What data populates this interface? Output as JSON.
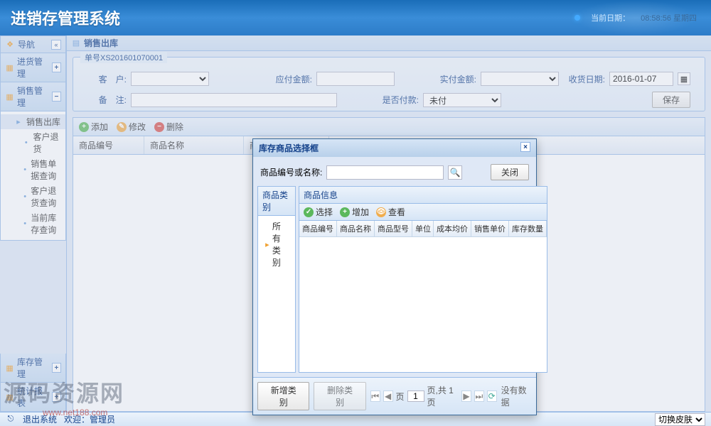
{
  "header": {
    "title": "进销存管理系统",
    "date_label": "当前日期：",
    "time": "08:58:56 星期四"
  },
  "sidebar": {
    "nav_title": "导航",
    "panels": {
      "purchase": "进货管理",
      "sales": "销售管理",
      "inventory": "库存管理",
      "stats": "统计报表"
    },
    "sales_tree": {
      "root": "销售出库",
      "items": [
        "客户退货",
        "销售单据查询",
        "客户退货查询",
        "当前库存查询"
      ]
    }
  },
  "tab": {
    "title": "销售出库"
  },
  "form": {
    "legend": "单号XS201601070001",
    "customer_label": "客　户:",
    "amount_due_label": "应付金额:",
    "amount_paid_label": "实付金额:",
    "receive_date_label": "收货日期:",
    "receive_date_value": "2016-01-07",
    "remark_label": "备　注:",
    "paid_flag_label": "是否付款:",
    "paid_flag_value": "未付",
    "save_btn": "保存"
  },
  "toolbar": {
    "add": "添加",
    "edit": "修改",
    "del": "删除"
  },
  "grid_cols": [
    "商品编号",
    "商品名称",
    "商品型号"
  ],
  "modal": {
    "title": "库存商品选择框",
    "search_label": "商品编号或名称:",
    "close_btn": "关闭",
    "cat_title": "商品类别",
    "cat_root": "所有类别",
    "info_title": "商品信息",
    "tb_select": "选择",
    "tb_add": "增加",
    "tb_view": "查看",
    "cols": [
      "商品编号",
      "商品名称",
      "商品型号",
      "单位",
      "成本均价",
      "销售单价",
      "库存数量"
    ],
    "footer_new": "新增类别",
    "footer_del": "删除类别",
    "page_input": "1",
    "page_text": "页,共 1 页",
    "no_data": "没有数据"
  },
  "footer": {
    "exit": "退出系统",
    "welcome": "欢迎：管理员",
    "skin": "切换皮肤"
  },
  "watermark": "源码资源网",
  "watermark_url": "www.net188.com"
}
